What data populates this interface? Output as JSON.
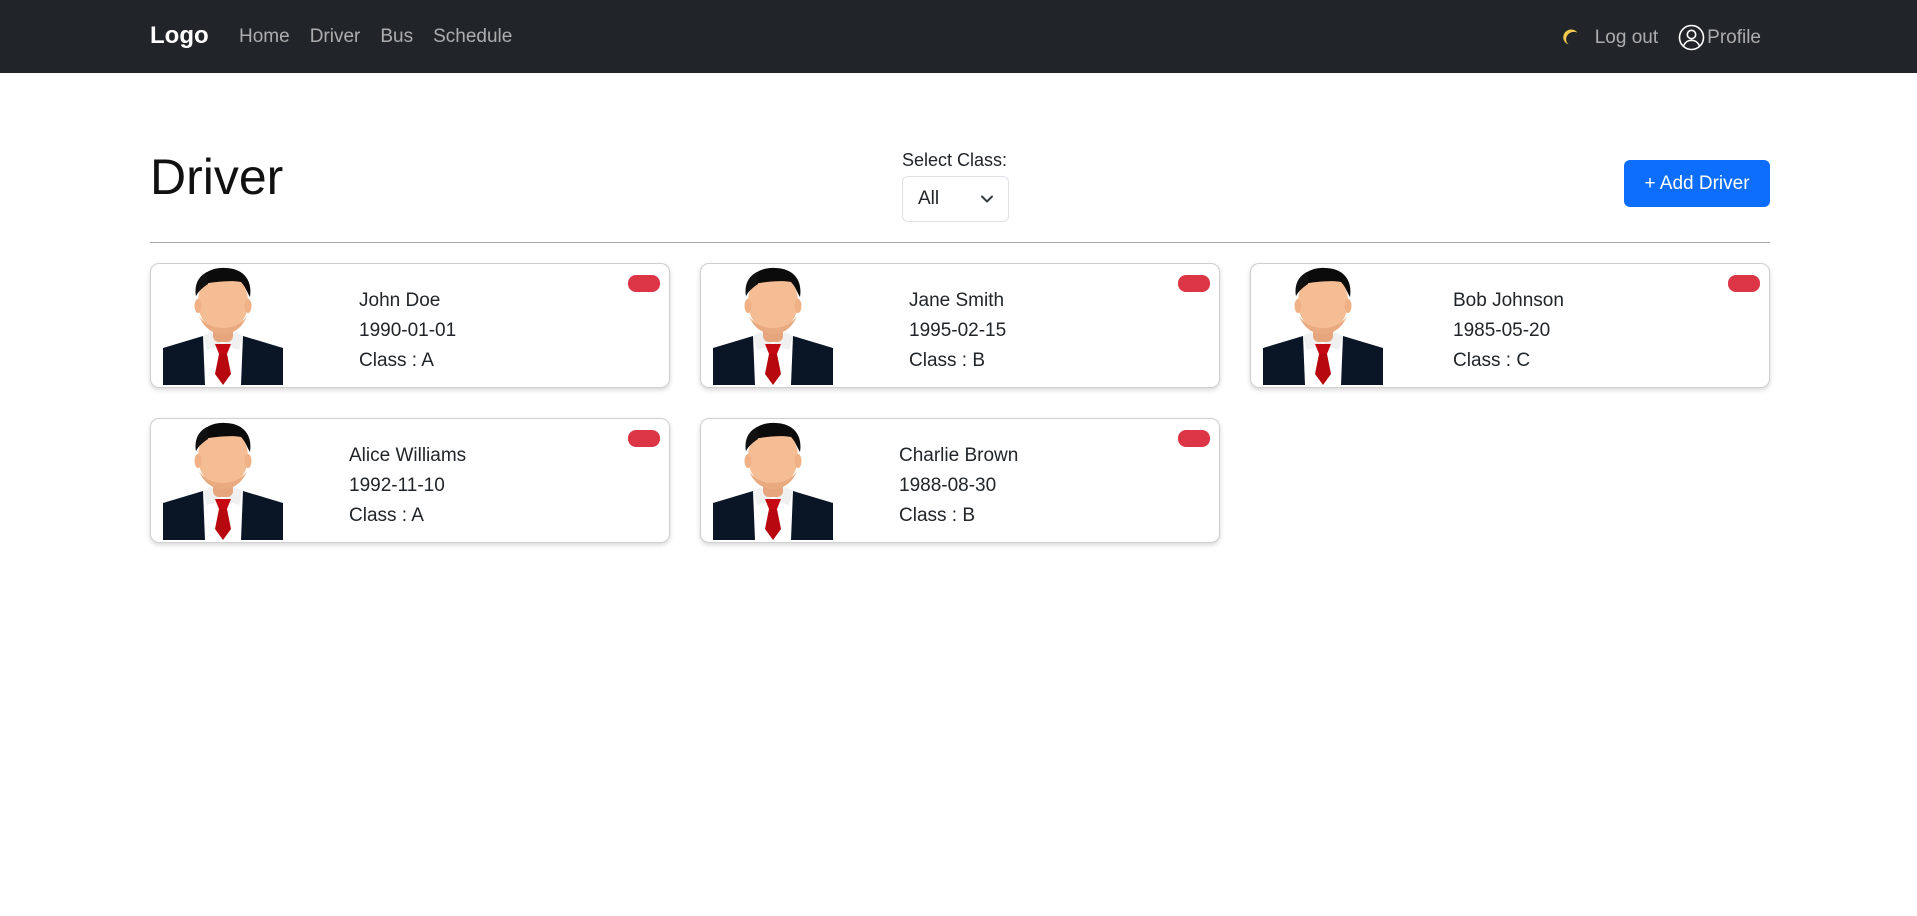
{
  "navbar": {
    "brand": "Logo",
    "links": [
      "Home",
      "Driver",
      "Bus",
      "Schedule"
    ],
    "theme_icon": "moon-icon",
    "logout_label": "Log out",
    "profile_label": "Profile",
    "profile_icon": "user-circle-icon"
  },
  "page": {
    "title": "Driver",
    "filter": {
      "label": "Select Class:",
      "value": "All"
    },
    "add_button": "+ Add Driver"
  },
  "drivers": [
    {
      "name": "John Doe",
      "dob": "1990-01-01",
      "class_text": "Class : A"
    },
    {
      "name": "Jane Smith",
      "dob": "1995-02-15",
      "class_text": "Class : B"
    },
    {
      "name": "Bob Johnson",
      "dob": "1985-05-20",
      "class_text": "Class : C"
    },
    {
      "name": "Alice Williams",
      "dob": "1992-11-10",
      "class_text": "Class : A"
    },
    {
      "name": "Charlie Brown",
      "dob": "1988-08-30",
      "class_text": "Class : B"
    }
  ],
  "colors": {
    "navbar_bg": "#212529",
    "primary": "#0d6efd",
    "danger": "#dc3545"
  }
}
